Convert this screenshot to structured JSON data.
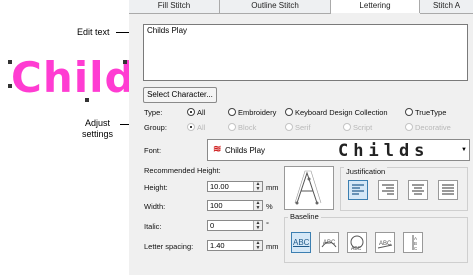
{
  "tabs": [
    {
      "label": "Fill Stitch",
      "active": false
    },
    {
      "label": "Outline Stitch",
      "active": false
    },
    {
      "label": "Lettering",
      "active": true
    },
    {
      "label": "Stitch A",
      "active": false
    }
  ],
  "callouts": {
    "edit_text": "Edit text",
    "adjust_settings_line1": "Adjust",
    "adjust_settings_line2": "settings"
  },
  "preview_text": "Child",
  "editor": {
    "value": "Childs Play"
  },
  "select_character_button": "Select Character...",
  "type": {
    "label": "Type:",
    "options": [
      {
        "label": "All",
        "selected": true,
        "disabled": false
      },
      {
        "label": "Embroidery",
        "selected": false,
        "disabled": false
      },
      {
        "label": "Keyboard Design Collection",
        "selected": false,
        "disabled": false
      },
      {
        "label": "TrueType",
        "selected": false,
        "disabled": false
      }
    ]
  },
  "group": {
    "label": "Group:",
    "options": [
      {
        "label": "All",
        "selected": true,
        "disabled": true
      },
      {
        "label": "Block",
        "selected": false,
        "disabled": true
      },
      {
        "label": "Serif",
        "selected": false,
        "disabled": true
      },
      {
        "label": "Script",
        "selected": false,
        "disabled": true
      },
      {
        "label": "Decorative",
        "selected": false,
        "disabled": true
      }
    ]
  },
  "font": {
    "label": "Font:",
    "value": "Childs Play",
    "sample": "Childs"
  },
  "recommended_height_label": "Recommended Height:",
  "fields": {
    "height": {
      "label": "Height:",
      "value": "10.00",
      "unit": "mm"
    },
    "width": {
      "label": "Width:",
      "value": "100",
      "unit": "%"
    },
    "italic": {
      "label": "Italic:",
      "value": "0",
      "unit": "°"
    },
    "letter_spacing": {
      "label": "Letter spacing:",
      "value": "1.40",
      "unit": "mm"
    }
  },
  "justification": {
    "label": "Justification",
    "selected": "left"
  },
  "baseline": {
    "label": "Baseline",
    "selected": "straight",
    "sample": "ABC"
  },
  "colors": {
    "accent": "#3c7fb1",
    "preview_pink": "#ff3cd2"
  }
}
